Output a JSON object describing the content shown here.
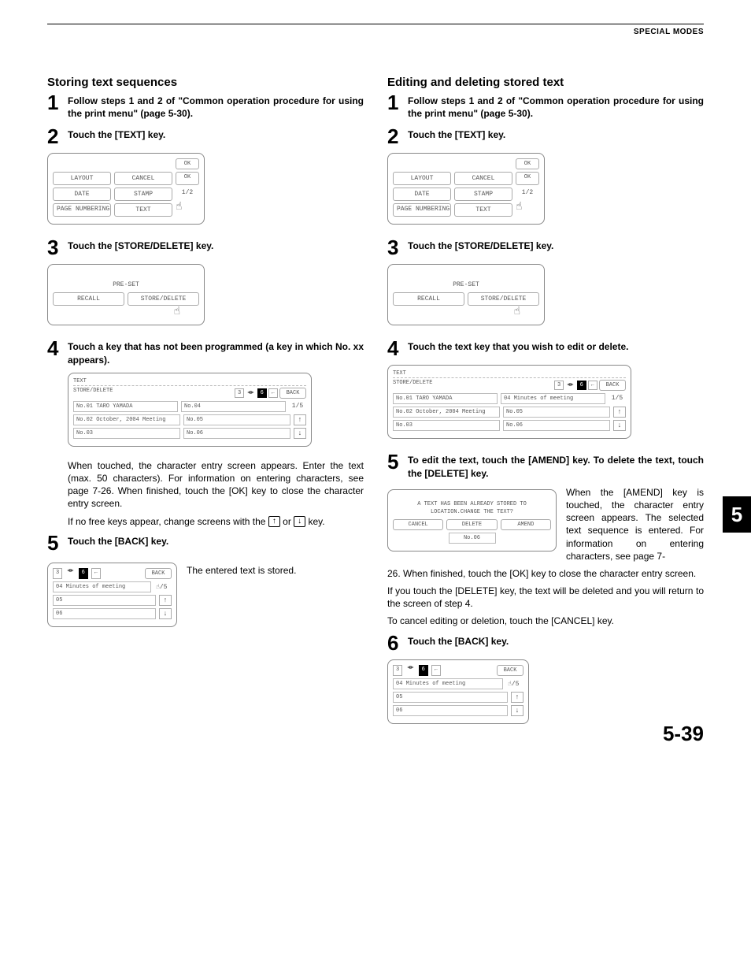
{
  "header": {
    "section": "SPECIAL MODES"
  },
  "page_number": "5-39",
  "tab": "5",
  "left": {
    "title": "Storing text sequences",
    "step1": "Follow steps 1 and 2 of \"Common operation procedure for using the print menu\" (page 5-30).",
    "step2": "Touch the [TEXT] key.",
    "step3": "Touch the [STORE/DELETE] key.",
    "step4": "Touch a key that has not been programmed (a key in which No. xx appears).",
    "body4a": "When touched, the character entry screen appears. Enter the text (max. 50 characters). For information on entering characters, see page 7-26. When finished, touch the [OK] key to close the character entry screen.",
    "body4b_pre": "If no free keys appear, change screens with the ",
    "body4b_mid": " or ",
    "body4b_post": " key.",
    "step5": "Touch the [BACK] key.",
    "body5": "The entered text is stored."
  },
  "right": {
    "title": "Editing and deleting stored text",
    "step1": "Follow steps 1 and 2 of \"Common operation procedure for using the print menu\" (page 5-30).",
    "step2": "Touch the [TEXT] key.",
    "step3": "Touch the [STORE/DELETE] key.",
    "step4": "Touch the text key that you wish to edit or delete.",
    "step5": "To edit the text, touch the [AMEND] key. To delete the text, touch the [DELETE] key.",
    "body5side": "When the [AMEND] key is touched, the character entry screen appears. The selected text sequence is entered. For information on entering characters, see page 7-",
    "body5cont": "26. When finished, touch the [OK] key to close the character entry screen.",
    "body5b": "If you touch the [DELETE] key, the text will be deleted and you will return to the screen of step 4.",
    "body5c": "To cancel editing or deletion, touch the [CANCEL] key.",
    "step6": "Touch the [BACK] key."
  },
  "ui": {
    "ok": "OK",
    "layout": "LAYOUT",
    "cancel": "CANCEL",
    "date": "DATE",
    "stamp": "STAMP",
    "page_numbering": "PAGE NUMBERING",
    "text": "TEXT",
    "frac12": "1/2",
    "preset": "PRE-SET",
    "recall": "RECALL",
    "store_delete": "STORE/DELETE",
    "back": "BACK",
    "frac15": "1/5",
    "text_crumb": "TEXT",
    "sd_crumb": "STORE/DELETE",
    "bar3": "3",
    "bar6": "6",
    "list": {
      "l1": "No.01 TARO YAMADA",
      "l2": "No.02 October, 2004 Meeting",
      "l3": "No.03",
      "l4": "No.04",
      "l5": "No.05",
      "l6": "No.06",
      "r4": "04 Minutes of meeting",
      "r5": "05",
      "r6": "06"
    },
    "dialog": {
      "msg": "A TEXT HAS BEEN ALREADY STORED TO LOCATION.CHANGE THE TEXT?",
      "cancel": "CANCEL",
      "delete": "DELETE",
      "amend": "AMEND",
      "no06": "No.06"
    }
  }
}
